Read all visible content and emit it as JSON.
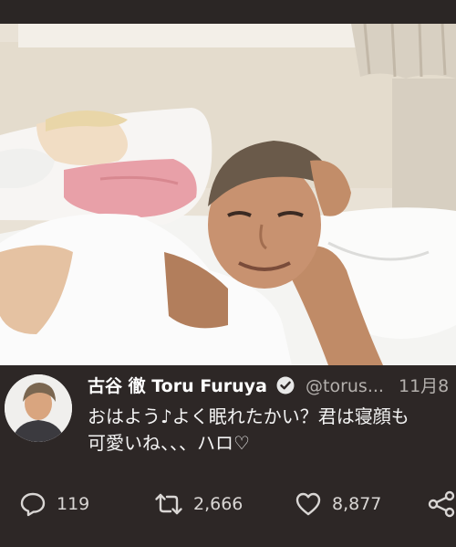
{
  "tweet": {
    "display_name": "古谷 徹 Toru Furuya",
    "handle": "@torus...",
    "date": "11月8",
    "text_line1": "おはよう♪よく眠れたかい？君は寝顔も",
    "text_line2": "可愛いね、、、ハロ♡",
    "reply_count": "119",
    "retweet_count": "2,666",
    "like_count": "8,877"
  },
  "icons": {
    "verified": "verified-badge-icon",
    "reply": "reply-icon",
    "retweet": "retweet-icon",
    "like": "heart-icon",
    "share": "share-icon"
  },
  "colors": {
    "background": "#2b2625",
    "text": "#f3f3f3",
    "muted": "#b4b0ad"
  }
}
